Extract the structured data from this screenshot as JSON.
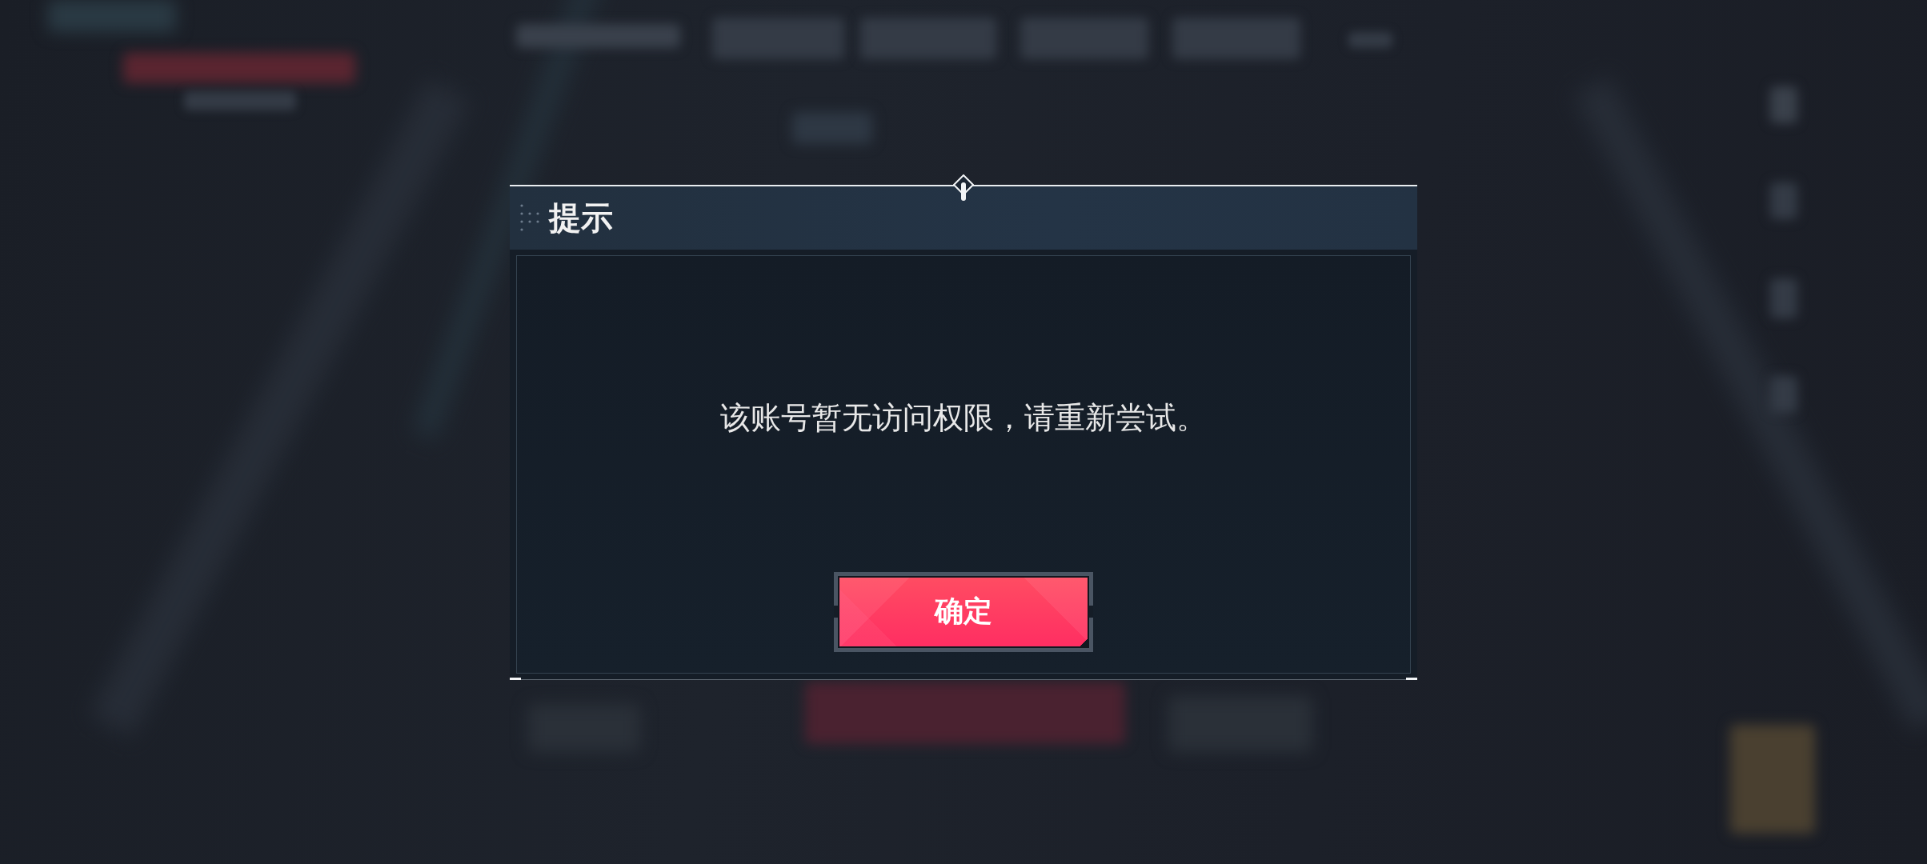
{
  "dialog": {
    "title": "提示",
    "message": "该账号暂无访问权限，请重新尝试。",
    "button": "确定"
  }
}
